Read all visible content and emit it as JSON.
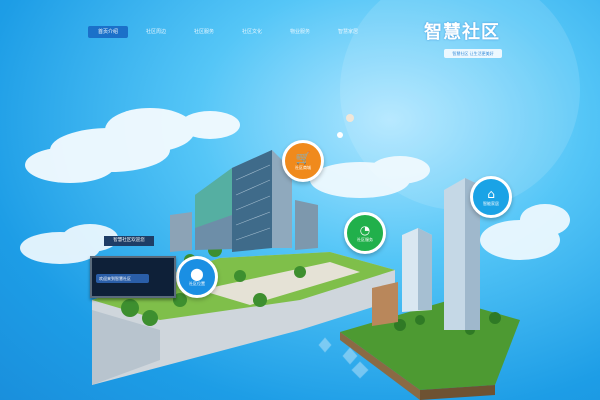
{
  "nav": {
    "items": [
      "首页介绍",
      "社区周边",
      "社区服务",
      "社区文化",
      "物业服务",
      "智慧家居"
    ],
    "active_index": 0
  },
  "brand": {
    "logo": "智慧社区",
    "subtitle": "智慧社区 让生活更美好"
  },
  "badges": {
    "shop": {
      "icon": "shopping-cart-icon",
      "label": "社区商城",
      "color": "#f08a1c"
    },
    "services": {
      "icon": "pie-icon",
      "label": "社区服务",
      "color": "#21b04b"
    },
    "home": {
      "icon": "home-icon",
      "label": "智能家居",
      "color": "#1aa3e6"
    },
    "location": {
      "icon": "location-pin-icon",
      "label": "社区位置",
      "color": "#1a8fe3"
    }
  },
  "board": {
    "title": "智慧社区欢迎您",
    "bubble": "欢迎来到智慧社区"
  },
  "colors": {
    "sky": "#55c6f7",
    "nav_active": "#1b70c9"
  }
}
